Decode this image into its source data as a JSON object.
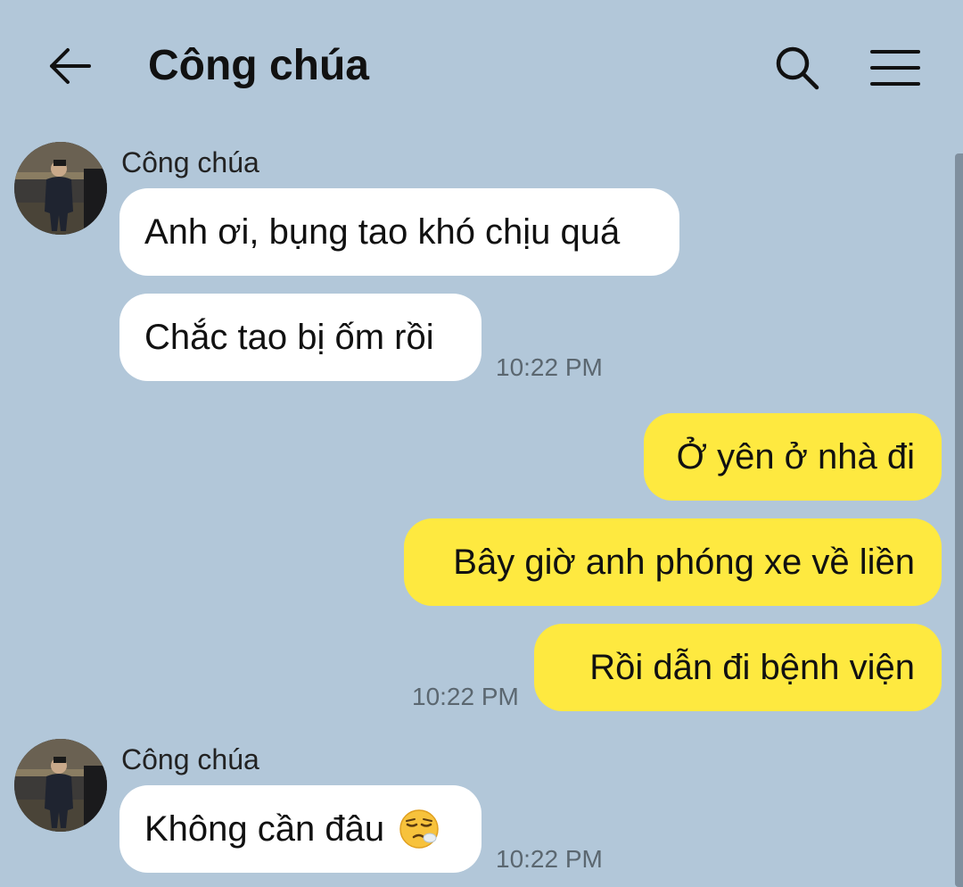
{
  "header": {
    "title": "Công chúa",
    "back_icon": "arrow-left-icon",
    "search_icon": "search-icon",
    "menu_icon": "menu-icon"
  },
  "colors": {
    "background": "#b2c7d9",
    "incoming_bubble": "#ffffff",
    "outgoing_bubble": "#fee940",
    "timestamp": "#5b6770"
  },
  "messages": [
    {
      "group": "incoming",
      "sender": "Công chúa",
      "avatar": "avatar-photo",
      "bubbles": [
        "Anh ơi, bụng tao khó chịu quá",
        "Chắc tao bị ốm rồi"
      ],
      "time": "10:22 PM"
    },
    {
      "group": "outgoing",
      "bubbles": [
        "Ở yên ở nhà đi",
        "Bây giờ anh phóng xe về liền",
        "Rồi dẫn đi bệnh viện"
      ],
      "time": "10:22 PM"
    },
    {
      "group": "incoming",
      "sender": "Công chúa",
      "avatar": "avatar-photo",
      "bubbles": [
        "Không cần đâu"
      ],
      "emoji": "sick-face-emoji",
      "time": "10:22 PM"
    }
  ]
}
